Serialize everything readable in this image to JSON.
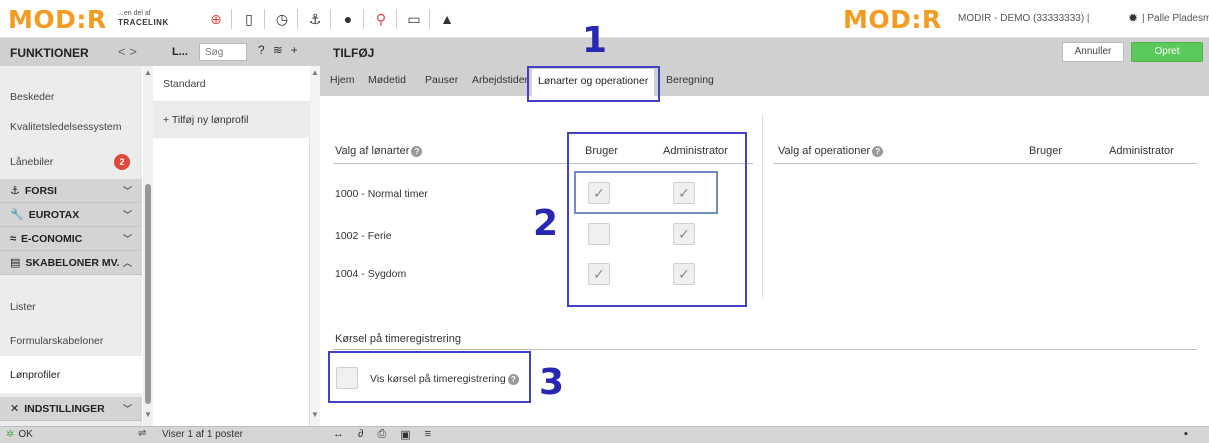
{
  "header": {
    "logo_text": "MOD:R",
    "logo_sub_top": "...en del af",
    "logo_sub_bottom": "TRACELINK",
    "account_text": "MODIR - DEMO (33333333)  |",
    "user_text": "|  Palle Pladesmed"
  },
  "toolbar": {
    "title": "FUNKTIONER",
    "nav_arrows": "<  >",
    "list_label": "L...",
    "search_placeholder": "Søg",
    "form_title": "TILFØJ",
    "cancel_label": "Annuller",
    "create_label": "Opret"
  },
  "sidebar": {
    "items": [
      {
        "label": "Beskeder"
      },
      {
        "label": "Kvalitetsledelsessystem"
      },
      {
        "label": "Lånebiler",
        "badge": "2"
      },
      {
        "label": "FORSI"
      },
      {
        "label": "EUROTAX"
      },
      {
        "label": "E-CONOMIC"
      },
      {
        "label": "SKABELONER MV."
      },
      {
        "label": "Lister"
      },
      {
        "label": "Formularskabeloner"
      },
      {
        "label": "Lønprofiler"
      },
      {
        "label": "INDSTILLINGER"
      }
    ]
  },
  "profiles": {
    "standard": "Standard",
    "add": "+ Tilføj ny lønprofil"
  },
  "tabs": [
    {
      "label": "Hjem"
    },
    {
      "label": "Mødetid"
    },
    {
      "label": "Pauser"
    },
    {
      "label": "Arbejdstider"
    },
    {
      "label": "Lønarter og operationer"
    },
    {
      "label": "Beregning"
    }
  ],
  "wage_types": {
    "heading": "Valg af lønarter",
    "col_user": "Bruger",
    "col_admin": "Administrator",
    "rows": [
      {
        "label": "1000 - Normal timer",
        "user": true,
        "admin": true
      },
      {
        "label": "1002 - Ferie",
        "user": false,
        "admin": true
      },
      {
        "label": "1004 - Sygdom",
        "user": true,
        "admin": true
      }
    ]
  },
  "operations": {
    "heading": "Valg af operationer",
    "col_user": "Bruger",
    "col_admin": "Administrator"
  },
  "driving": {
    "heading": "Kørsel på timeregistrering",
    "checkbox_label": "Vis kørsel på timeregistrering",
    "checked": false
  },
  "annotations": [
    "1",
    "2",
    "3"
  ],
  "status": {
    "ok": "OK",
    "count": "Viser 1 af 1 poster"
  },
  "colors": {
    "brand_orange": "#f39c21",
    "create_green": "#5cc95c",
    "annotation_blue": "#2727b4",
    "badge_red": "#e0483b"
  }
}
